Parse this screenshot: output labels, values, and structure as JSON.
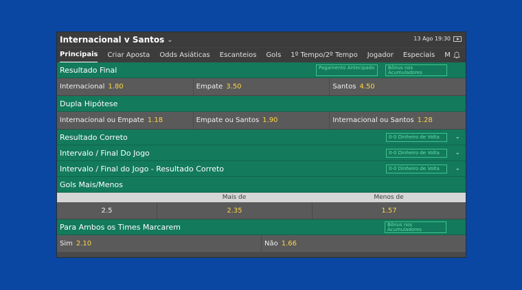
{
  "header": {
    "title": "Internacional v Santos",
    "datetime": "13 Ago 19:30"
  },
  "tabs": [
    "Principais",
    "Criar Aposta",
    "Odds Asiáticas",
    "Escanteios",
    "Gols",
    "1º Tempo/2º Tempo",
    "Jogador",
    "Especiais",
    "M"
  ],
  "resultado_final": {
    "title": "Resultado Final",
    "badge1": "Pagamento Antecipado",
    "badge2": "Bônus nos Acumuladores",
    "options": [
      {
        "label": "Internacional",
        "odd": "1.80"
      },
      {
        "label": "Empate",
        "odd": "3.50"
      },
      {
        "label": "Santos",
        "odd": "4.50"
      }
    ]
  },
  "dupla_hipotese": {
    "title": "Dupla Hipótese",
    "options": [
      {
        "label": "Internacional ou Empate",
        "odd": "1.18"
      },
      {
        "label": "Empate ou Santos",
        "odd": "1.90"
      },
      {
        "label": "Internacional ou Santos",
        "odd": "1.28"
      }
    ]
  },
  "collapsed": [
    {
      "title": "Resultado Correto",
      "badge": "0-0 Dinheiro de Volta"
    },
    {
      "title": "Intervalo / Final Do Jogo",
      "badge": "0-0 Dinheiro de Volta"
    },
    {
      "title": "Intervalo / Final do Jogo - Resultado Correto",
      "badge": "0-0 Dinheiro de Volta"
    }
  ],
  "gols": {
    "title": "Gols Mais/Menos",
    "col_mais": "Mais de",
    "col_menos": "Menos de",
    "line": "2.5",
    "mais_odd": "2.35",
    "menos_odd": "1.57"
  },
  "ambos": {
    "title": "Para Ambos os Times Marcarem",
    "badge": "Bônus nos Acumuladores",
    "options": [
      {
        "label": "Sim",
        "odd": "2.10"
      },
      {
        "label": "Não",
        "odd": "1.66"
      }
    ]
  },
  "colors": {
    "background": "#0a47a3",
    "section_green": "#137a5b",
    "odd_yellow": "#ffd54a",
    "badge_green": "#63e3a8"
  }
}
